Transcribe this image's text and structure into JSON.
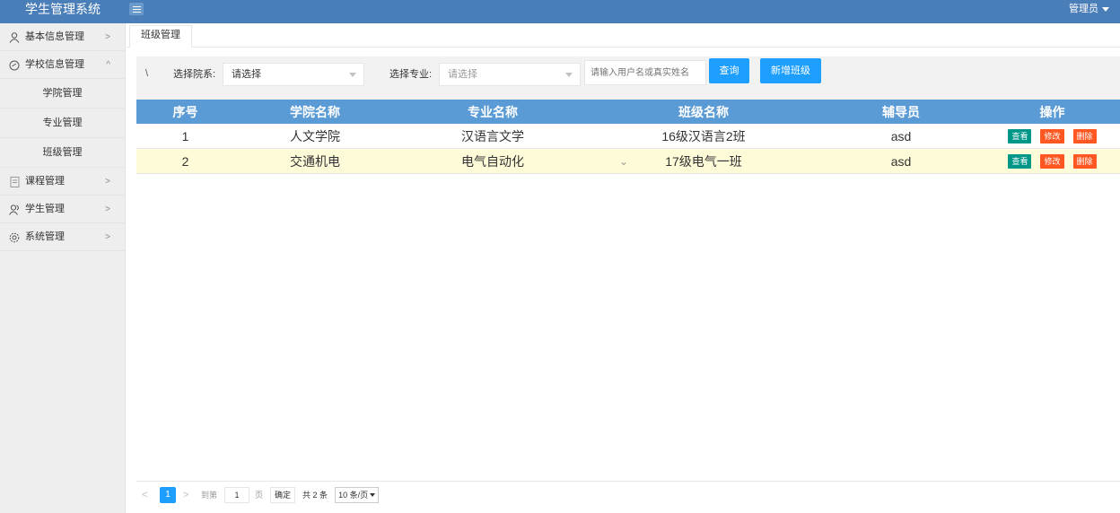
{
  "header": {
    "brand": "学生管理系统",
    "user": "管理员"
  },
  "sidebar": {
    "items": [
      {
        "label": "基本信息管理",
        "icon": "user-icon",
        "expanded": false
      },
      {
        "label": "学校信息管理",
        "icon": "clock-icon",
        "expanded": true
      },
      {
        "label": "课程管理",
        "icon": "document-icon",
        "expanded": false
      },
      {
        "label": "学生管理",
        "icon": "users-icon",
        "expanded": false
      },
      {
        "label": "系统管理",
        "icon": "gear-icon",
        "expanded": false
      }
    ],
    "subitems": [
      "学院管理",
      "专业管理",
      "班级管理"
    ]
  },
  "tab": {
    "label": "班级管理"
  },
  "filter": {
    "slash": "\\",
    "dept_label": "选择院系:",
    "dept_value": "请选择",
    "major_label": "选择专业:",
    "major_value": "请选择",
    "search_placeholder": "请输入用户名或真实姓名",
    "query_label": "查询",
    "add_label": "新增班级"
  },
  "table": {
    "headers": [
      "序号",
      "学院名称",
      "专业名称",
      "班级名称",
      "辅导员",
      "操作"
    ],
    "rows": [
      {
        "no": "1",
        "college": "人文学院",
        "major": "汉语言文学",
        "class": "16级汉语言2班",
        "counselor": "asd"
      },
      {
        "no": "2",
        "college": "交通机电",
        "major": "电气自动化",
        "class": "17级电气一班",
        "counselor": "asd"
      }
    ],
    "ops": {
      "view": "查看",
      "edit": "修改",
      "delete": "删除"
    }
  },
  "pager": {
    "current": "1",
    "goto_label": "到第",
    "page_input": "1",
    "page_unit": "页",
    "confirm": "确定",
    "total": "共 2 条",
    "page_size": "10 条/页"
  },
  "colors": {
    "header": "#4a7eb8",
    "table_header": "#5b9bd5",
    "primary": "#1e9fff",
    "view": "#009688",
    "danger": "#ff5722",
    "highlight_row": "#fefbd8"
  }
}
